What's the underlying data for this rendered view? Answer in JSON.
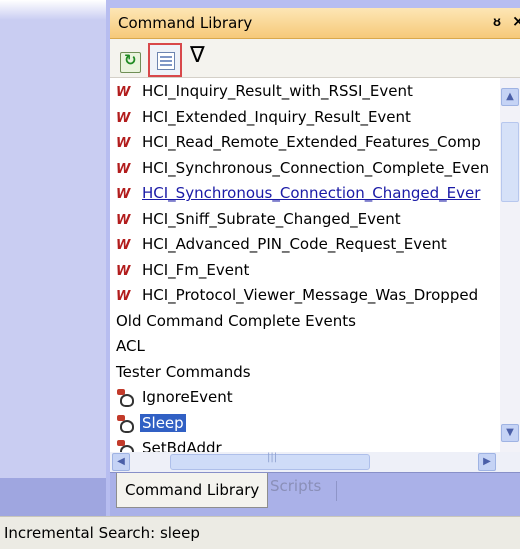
{
  "panel": {
    "title": "Command Library",
    "pin_glyph": "p",
    "close_glyph": "×"
  },
  "toolbar": {
    "refresh_icon": "refresh-icon",
    "grid_icon": "document-view-icon",
    "filter_glyph": "∇"
  },
  "list": {
    "items": [
      {
        "type": "event",
        "label": "HCI_Inquiry_Result_with_RSSI_Event"
      },
      {
        "type": "event",
        "label": "HCI_Extended_Inquiry_Result_Event"
      },
      {
        "type": "event",
        "label": "HCI_Read_Remote_Extended_Features_Comp"
      },
      {
        "type": "event",
        "label": "HCI_Synchronous_Connection_Complete_Even"
      },
      {
        "type": "event",
        "label": "HCI_Synchronous_Connection_Changed_Ever",
        "style": "link"
      },
      {
        "type": "event",
        "label": "HCI_Sniff_Subrate_Changed_Event"
      },
      {
        "type": "event",
        "label": "HCI_Advanced_PIN_Code_Request_Event"
      },
      {
        "type": "event",
        "label": "HCI_Fm_Event"
      },
      {
        "type": "event",
        "label": "HCI_Protocol_Viewer_Message_Was_Dropped"
      },
      {
        "type": "category",
        "label": "Old Command Complete Events"
      },
      {
        "type": "category",
        "label": "ACL"
      },
      {
        "type": "category",
        "label": "Tester Commands"
      },
      {
        "type": "command",
        "label": "IgnoreEvent"
      },
      {
        "type": "command",
        "label": "Sleep",
        "selected": true
      },
      {
        "type": "command",
        "label": "SetBdAddr"
      }
    ]
  },
  "tabs": {
    "active": "Command Library",
    "inactive": "Scripts"
  },
  "status": {
    "text": "Incremental Search: sleep"
  },
  "colors": {
    "title_bar": "#f6c979",
    "selection": "#3160c4",
    "link": "#1a1aa6",
    "event_icon": "#b21c1c"
  }
}
